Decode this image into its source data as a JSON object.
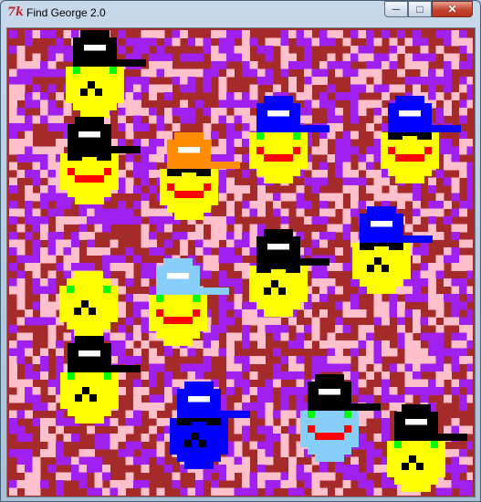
{
  "window": {
    "title": "Find George 2.0",
    "icon": "tk-feather-icon",
    "controls": {
      "minimize": "minimize-icon",
      "maximize": "maximize-icon",
      "close": "close-icon"
    }
  },
  "colors": {
    "noise": [
      "#a52a2a",
      "#a020f0",
      "#ffc0cb"
    ],
    "face": "#ffff00",
    "eyes": "#00ff00",
    "mouth": "#ff0000",
    "hat_black": "#000000",
    "hat_blue": "#0000ff",
    "hat_orange": "#ff8c00",
    "hat_lightblue": "#87cefa",
    "face_blue": "#0000ff",
    "face_lightblue": "#87cefa"
  },
  "characters": [
    {
      "face": "yellow",
      "hat": "black",
      "glasses": false,
      "mouth": "frown"
    },
    {
      "face": "yellow",
      "hat": "black",
      "glasses": true,
      "mouth": "smile"
    },
    {
      "face": "yellow",
      "hat": "blue",
      "glasses": false,
      "mouth": "smile"
    },
    {
      "face": "yellow",
      "hat": "orange",
      "glasses": true,
      "mouth": "smile"
    },
    {
      "face": "yellow",
      "hat": "blue",
      "glasses": true,
      "mouth": "smile"
    },
    {
      "face": "yellow",
      "hat": "none",
      "glasses": false,
      "mouth": "frown"
    },
    {
      "face": "yellow",
      "hat": "lightblue",
      "glasses": false,
      "mouth": "smile"
    },
    {
      "face": "yellow",
      "hat": "black",
      "glasses": true,
      "mouth": "frown"
    },
    {
      "face": "yellow",
      "hat": "blue",
      "glasses": true,
      "mouth": "frown"
    },
    {
      "face": "yellow",
      "hat": "black",
      "glasses": false,
      "mouth": "frown"
    },
    {
      "face": "blue",
      "hat": "blue",
      "glasses": true,
      "mouth": "frown"
    },
    {
      "face": "lightblue",
      "hat": "black",
      "glasses": false,
      "mouth": "smile"
    },
    {
      "face": "yellow",
      "hat": "black",
      "glasses": false,
      "mouth": "frown"
    }
  ]
}
